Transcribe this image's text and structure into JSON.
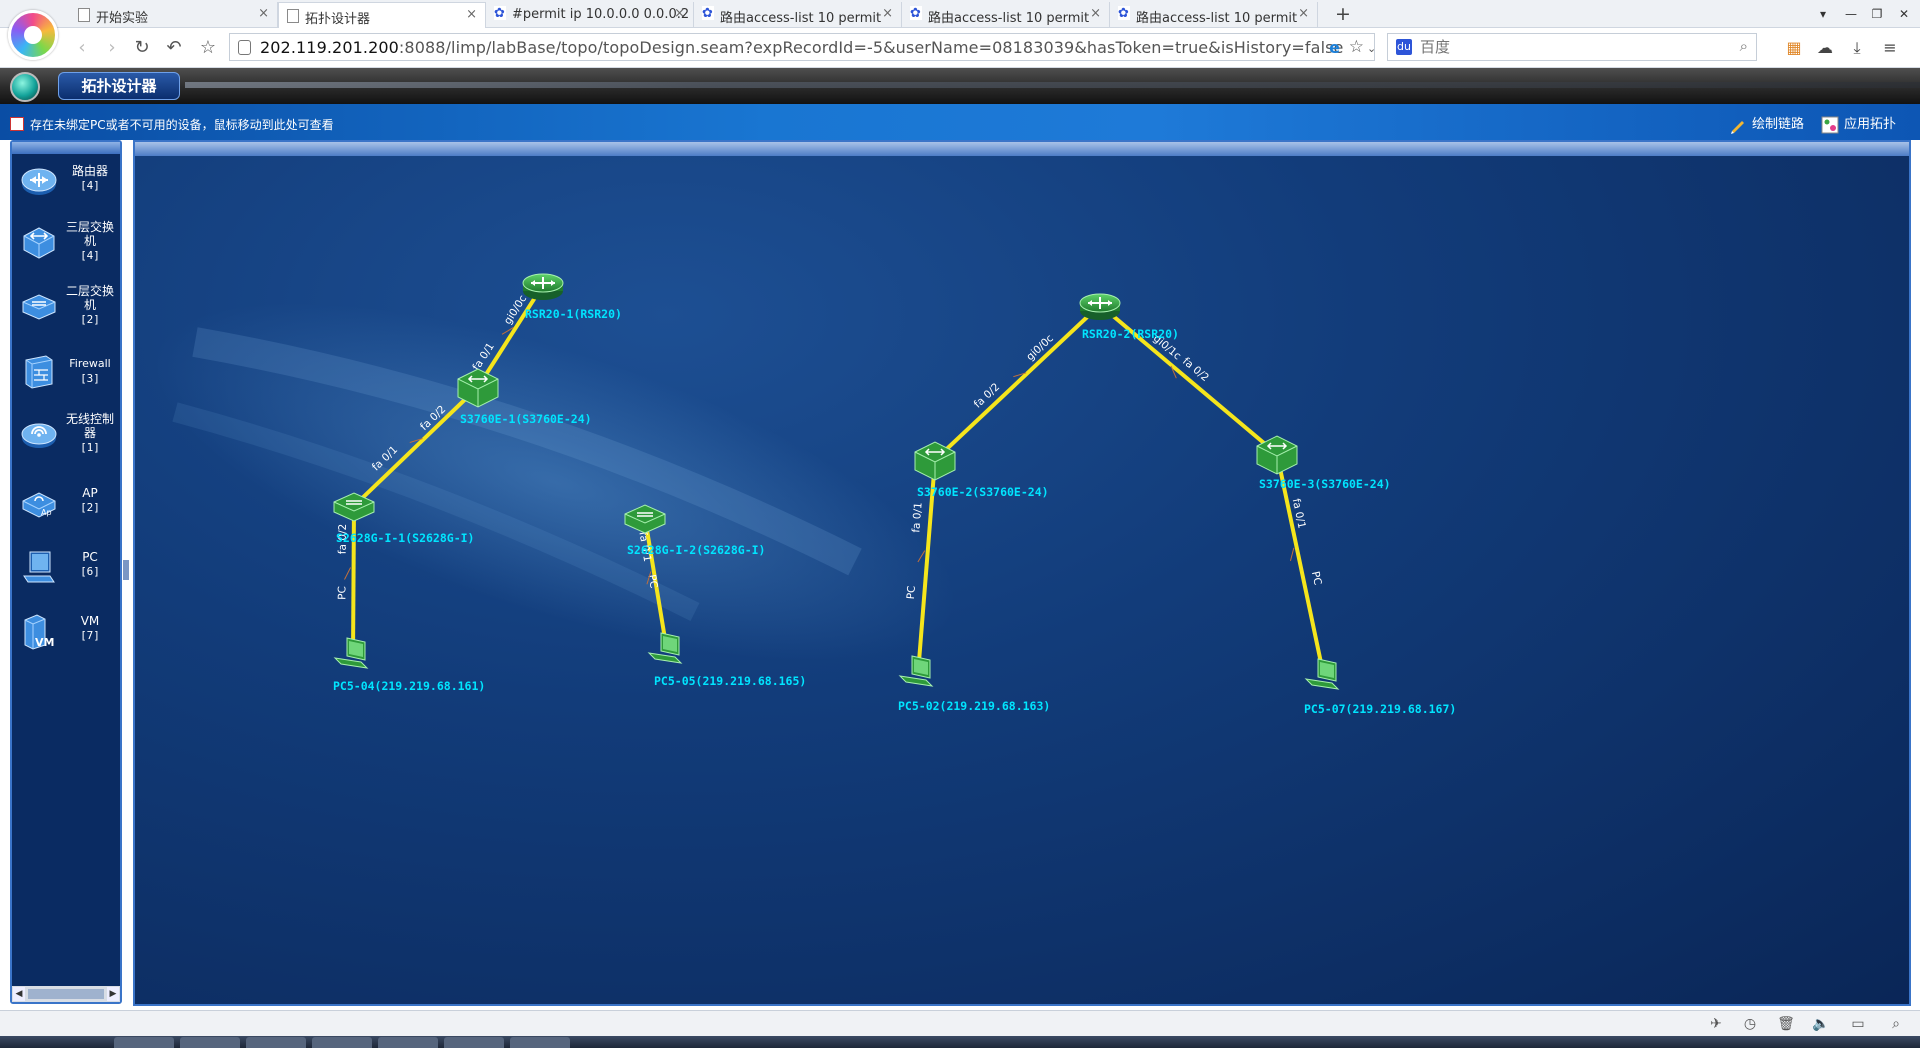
{
  "browser": {
    "tabs": [
      {
        "label": "开始实验",
        "icon": "page-icon"
      },
      {
        "label": "拓扑设计器",
        "icon": "page-icon",
        "active": true
      },
      {
        "label": "#permit ip 10.0.0.0 0.0.0.2",
        "icon": "baidu-paw-icon"
      },
      {
        "label": "路由access-list 10 permit",
        "icon": "baidu-paw-icon"
      },
      {
        "label": "路由access-list 10 permit",
        "icon": "baidu-paw-icon"
      },
      {
        "label": "路由access-list 10 permit",
        "icon": "baidu-paw-icon"
      }
    ],
    "tab_close": "×",
    "new_tab": "+",
    "url_host": "202.119.201.200",
    "url_rest": ":8088/limp/labBase/topo/topoDesign.seam?expRecordId=-5&userName=08183039&hasToken=true&isHistory=false",
    "search_placeholder": "百度"
  },
  "app": {
    "title": "拓扑设计器",
    "warning": "存在未绑定PC或者不可用的设备，鼠标移动到此处可查看",
    "actions": {
      "draw_link": "绘制链路",
      "apply_topo": "应用拓扑"
    }
  },
  "palette": [
    {
      "name": "路由器",
      "count": "[4]",
      "icon": "router-icon"
    },
    {
      "name": "三层交换机",
      "count": "[4]",
      "icon": "l3-switch-icon"
    },
    {
      "name": "二层交换机",
      "count": "[2]",
      "icon": "l2-switch-icon"
    },
    {
      "name": "Firewall",
      "count": "[3]",
      "icon": "firewall-icon"
    },
    {
      "name": "无线控制器",
      "count": "[1]",
      "icon": "wireless-controller-icon"
    },
    {
      "name": "AP",
      "count": "[2]",
      "icon": "ap-icon"
    },
    {
      "name": "PC",
      "count": "[6]",
      "icon": "pc-icon"
    },
    {
      "name": "VM",
      "count": "[7]",
      "icon": "vm-icon"
    }
  ],
  "topology": {
    "nodes": [
      {
        "id": "r1",
        "type": "router",
        "label": "RSR20-1(RSR20)"
      },
      {
        "id": "r2",
        "type": "router",
        "label": "RSR20-2(RSR20)"
      },
      {
        "id": "s1",
        "type": "l3switch",
        "label": "S3760E-1(S3760E-24)"
      },
      {
        "id": "s2",
        "type": "l3switch",
        "label": "S3760E-2(S3760E-24)"
      },
      {
        "id": "s3",
        "type": "l3switch",
        "label": "S3760E-3(S3760E-24)"
      },
      {
        "id": "l1",
        "type": "l2switch",
        "label": "S2628G-I-1(S2628G-I)"
      },
      {
        "id": "l2",
        "type": "l2switch",
        "label": "S2628G-I-2(S2628G-I)"
      },
      {
        "id": "p4",
        "type": "pc",
        "label": "PC5-04(219.219.68.161)"
      },
      {
        "id": "p5",
        "type": "pc",
        "label": "PC5-05(219.219.68.165)"
      },
      {
        "id": "p2",
        "type": "pc",
        "label": "PC5-02(219.219.68.163)"
      },
      {
        "id": "p7",
        "type": "pc",
        "label": "PC5-07(219.219.68.167)"
      }
    ],
    "links": [
      {
        "from": "r1",
        "to": "s1",
        "from_port": "gi0/0c",
        "to_port": "fa 0/1"
      },
      {
        "from": "s1",
        "to": "l1",
        "from_port": "fa 0/2",
        "to_port": "fa 0/1"
      },
      {
        "from": "l1",
        "to": "p4",
        "from_port": "fa 0/2",
        "to_port": "PC"
      },
      {
        "from": "l2",
        "to": "p5",
        "from_port": "fa 0/1",
        "to_port": "PC"
      },
      {
        "from": "r2",
        "to": "s2",
        "from_port": "gi0/0c",
        "to_port": "fa 0/2"
      },
      {
        "from": "r2",
        "to": "s3",
        "from_port": "gi0/1c",
        "to_port": "fa 0/2"
      },
      {
        "from": "s2",
        "to": "p2",
        "from_port": "fa 0/1",
        "to_port": "PC"
      },
      {
        "from": "s3",
        "to": "p7",
        "from_port": "fa 0/1",
        "to_port": "PC"
      }
    ]
  },
  "colors": {
    "link": "#f5e51c",
    "label": "#00e5ff",
    "canvas": "#123c7a",
    "device": "#2e9a3a"
  }
}
